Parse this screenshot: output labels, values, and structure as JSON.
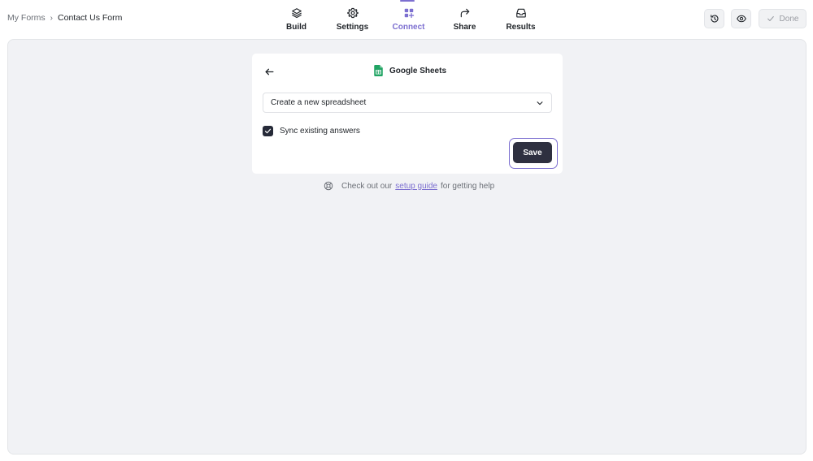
{
  "breadcrumb": {
    "parent": "My Forms",
    "separator": "›",
    "current": "Contact Us Form"
  },
  "nav": {
    "tabs": [
      {
        "label": "Build",
        "icon": "layers-icon",
        "active": false
      },
      {
        "label": "Settings",
        "icon": "gear-icon",
        "active": false
      },
      {
        "label": "Connect",
        "icon": "grid-plus-icon",
        "active": true
      },
      {
        "label": "Share",
        "icon": "share-arrow-icon",
        "active": false
      },
      {
        "label": "Results",
        "icon": "inbox-icon",
        "active": false
      }
    ]
  },
  "toolbar": {
    "history_icon": "history-icon",
    "preview_icon": "eye-icon",
    "done_label": "Done"
  },
  "card": {
    "title": "Google Sheets",
    "icon": "google-sheets-icon",
    "select_value": "Create a new spreadsheet",
    "sync_label": "Sync existing answers",
    "sync_checked": true,
    "save_label": "Save"
  },
  "help": {
    "prefix": "Check out our",
    "link": "setup guide",
    "suffix": "for getting help"
  },
  "colors": {
    "accent": "#7c6fd0",
    "dark_button": "#2e3040",
    "canvas": "#f1f2f5",
    "sheets_green": "#21a464"
  }
}
